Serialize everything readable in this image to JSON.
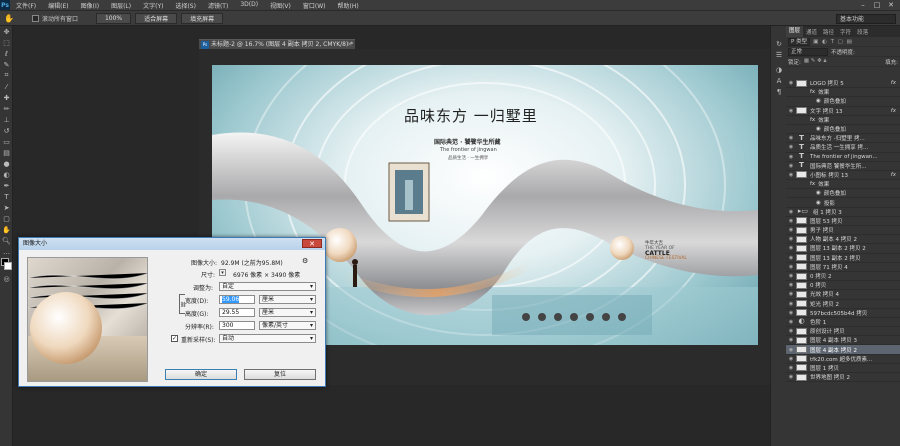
{
  "menubar": {
    "logo": "Ps",
    "items": [
      "文件(F)",
      "编辑(E)",
      "图像(I)",
      "图层(L)",
      "文字(Y)",
      "选择(S)",
      "滤镜(T)",
      "3D(D)",
      "视图(V)",
      "窗口(W)",
      "帮助(H)"
    ]
  },
  "optbar": {
    "scroll_all_label": "滚动所有窗口",
    "zoom_100": "100%",
    "fit_screen": "适合屏幕",
    "fill_screen": "填充屏幕",
    "workspace": "基本功能"
  },
  "document": {
    "tab_title": "未标题-2 @ 16.7% (图层 4 副本 拷贝 2, CMYK/8) *",
    "poster": {
      "headline": "品味东方 一归墅里",
      "sub1": "国际典范 · 饕餮华生所藏",
      "sub2": "The frontier of jingwan",
      "sub3": "品质生活 · 一生拥享",
      "badge_cn": "牛年大吉",
      "badge_l1": "THE YEAR OF",
      "badge_l2": "CATTLE",
      "badge_l3": "CHINESE FESTIVAL",
      "accent": "#b26a2e"
    }
  },
  "dialog": {
    "title": "图像大小",
    "size_label": "图像大小:",
    "size_value": "92.9M (之前为95.8M)",
    "dims_label": "尺寸:",
    "dims_value": "6976 像素 × 3490 像素",
    "fit_label": "调整为:",
    "fit_value": "自定",
    "width_label": "宽度(D):",
    "width_value": "59.06",
    "width_unit": "厘米",
    "height_label": "高度(G):",
    "height_value": "29.55",
    "height_unit": "厘米",
    "res_label": "分辨率(R):",
    "res_value": "300",
    "res_unit": "像素/英寸",
    "resample_label": "重新采样(S):",
    "resample_value": "自动",
    "ok": "确定",
    "reset": "复位"
  },
  "panel": {
    "tabs": [
      "图层",
      "通道",
      "路径",
      "字符",
      "段落"
    ],
    "kind_label": "P 类型",
    "blend_mode": "正常",
    "opacity_label": "不透明度:",
    "lock_label": "锁定:",
    "fill_label": "填充:",
    "layers": [
      {
        "name": "LOGO 拷贝 5",
        "type": "img",
        "fx": true
      },
      {
        "name": "效果",
        "type": "sub"
      },
      {
        "name": "颜色叠加",
        "type": "sub2"
      },
      {
        "name": "文字 拷贝 13",
        "type": "img",
        "fx": true
      },
      {
        "name": "效果",
        "type": "sub"
      },
      {
        "name": "颜色叠加",
        "type": "sub2"
      },
      {
        "name": "品味东方 -归墅里 拷...",
        "type": "text"
      },
      {
        "name": "品质生活 一生拥享 拷...",
        "type": "text"
      },
      {
        "name": "The frontier of jingwan...",
        "type": "text"
      },
      {
        "name": "国际典范 饕餮华生所...",
        "type": "text"
      },
      {
        "name": "小图标 拷贝 13",
        "type": "img",
        "fx": true
      },
      {
        "name": "效果",
        "type": "sub"
      },
      {
        "name": "颜色叠加",
        "type": "sub2"
      },
      {
        "name": "投影",
        "type": "sub2"
      },
      {
        "name": "组 1 拷贝 3",
        "type": "group"
      },
      {
        "name": "图层 53 拷贝",
        "type": "img"
      },
      {
        "name": "男子 拷贝",
        "type": "img"
      },
      {
        "name": "人物 副本 4 拷贝 2",
        "type": "img"
      },
      {
        "name": "图层 13 副本 2 拷贝 2",
        "type": "img"
      },
      {
        "name": "图层 13 副本 2 拷贝",
        "type": "img"
      },
      {
        "name": "图层 71 拷贝 4",
        "type": "img"
      },
      {
        "name": "0 拷贝 2",
        "type": "img"
      },
      {
        "name": "0 拷贝",
        "type": "img"
      },
      {
        "name": "光效 拷贝 4",
        "type": "img"
      },
      {
        "name": "矩光 拷贝 2",
        "type": "img"
      },
      {
        "name": "597bcdc505b4d 拷贝",
        "type": "img"
      },
      {
        "name": "色阶 1",
        "type": "adj"
      },
      {
        "name": "原创设计 拷贝",
        "type": "img"
      },
      {
        "name": "图层 4 副本 拷贝 3",
        "type": "img"
      },
      {
        "name": "图层 4 副本 拷贝 2",
        "type": "img",
        "selected": true
      },
      {
        "name": "tfk20.com 超多优质素...",
        "type": "img"
      },
      {
        "name": "图层 1 拷贝",
        "type": "img"
      },
      {
        "name": "世界地图 拷贝 2",
        "type": "img"
      }
    ]
  }
}
